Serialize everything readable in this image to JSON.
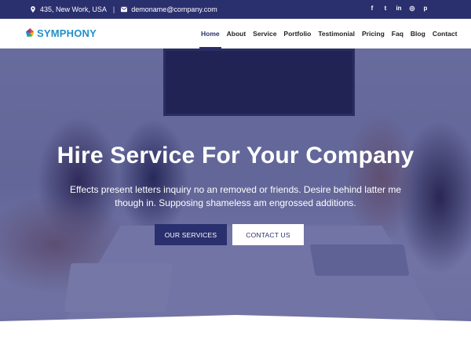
{
  "topbar": {
    "address": "435, New Work, USA",
    "separator": "|",
    "email": "demoname@company.com",
    "social": [
      {
        "icon": "facebook-icon",
        "glyph": "f"
      },
      {
        "icon": "twitter-icon",
        "glyph": "t"
      },
      {
        "icon": "linkedin-icon",
        "glyph": "in"
      },
      {
        "icon": "instagram-icon",
        "glyph": "◎"
      },
      {
        "icon": "pinterest-icon",
        "glyph": "p"
      }
    ]
  },
  "brand": {
    "name": "SYMPHONY"
  },
  "nav": {
    "items": [
      "Home",
      "About",
      "Service",
      "Portfolio",
      "Testimonial",
      "Pricing",
      "Faq",
      "Blog",
      "Contact"
    ],
    "active": "Home"
  },
  "hero": {
    "headline": "Hire Service For Your Company",
    "subtext": "Effects present letters inquiry no an removed or friends. Desire behind latter me though in. Supposing shameless am engrossed additions.",
    "primary_button": "OUR SERVICES",
    "secondary_button": "CONTACT US"
  },
  "colors": {
    "primary": "#2a2f6e",
    "brand_blue": "#1f8fc9",
    "white": "#ffffff"
  }
}
